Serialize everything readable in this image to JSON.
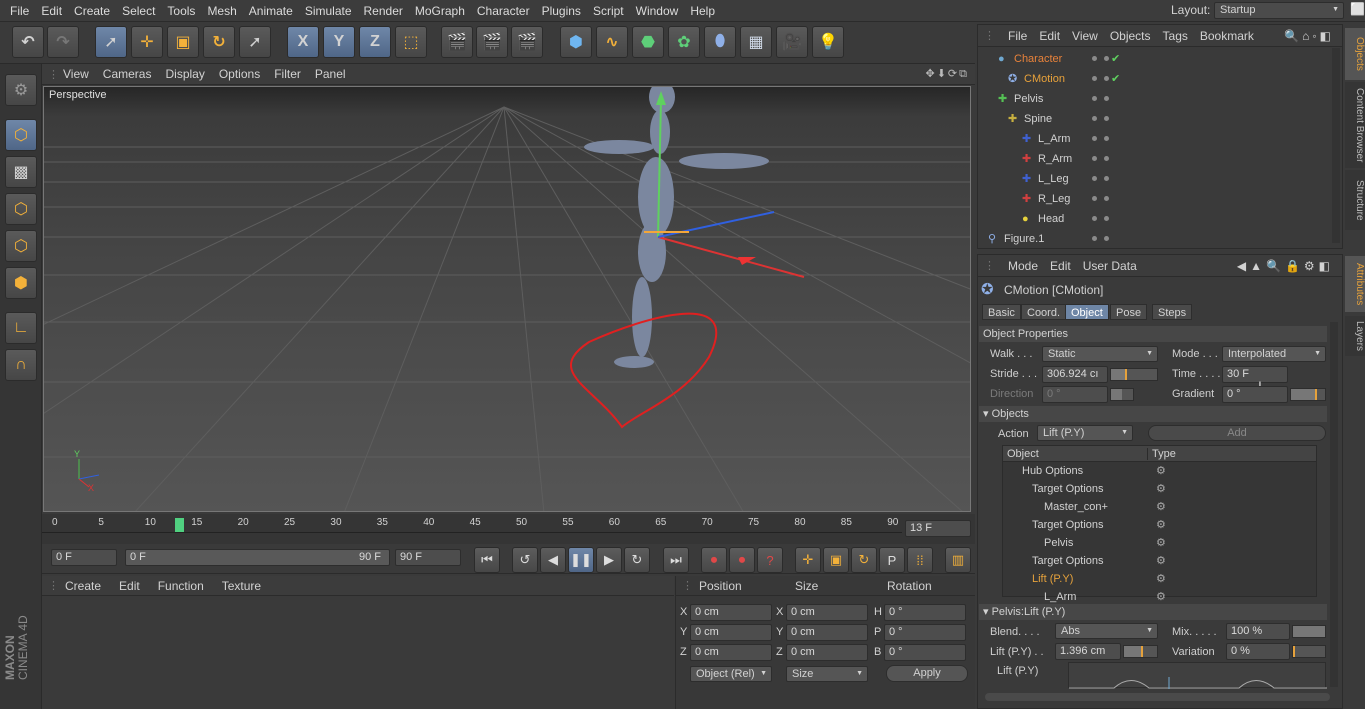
{
  "menubar": {
    "items": [
      "File",
      "Edit",
      "Create",
      "Select",
      "Tools",
      "Mesh",
      "Animate",
      "Simulate",
      "Render",
      "MoGraph",
      "Character",
      "Plugins",
      "Script",
      "Window",
      "Help"
    ],
    "layout_label": "Layout:",
    "layout_value": "Startup"
  },
  "toolbar": {
    "axis_x": "X",
    "axis_y": "Y",
    "axis_z": "Z"
  },
  "viewport": {
    "menu": [
      "View",
      "Cameras",
      "Display",
      "Options",
      "Filter",
      "Panel"
    ],
    "label": "Perspective",
    "axis_y": "Y",
    "axis_x": "X"
  },
  "timeline": {
    "ticks": [
      "0",
      "5",
      "10",
      "15",
      "20",
      "25",
      "30",
      "35",
      "40",
      "45",
      "50",
      "55",
      "60",
      "65",
      "70",
      "75",
      "80",
      "85",
      "90"
    ],
    "current_frame": "13 F",
    "playhead_frame": 13,
    "start": "0 F",
    "range_start": "0 F",
    "range_end": "90 F",
    "end": "90 F"
  },
  "material": {
    "menu": [
      "Create",
      "Edit",
      "Function",
      "Texture"
    ]
  },
  "coord": {
    "headers": [
      "Position",
      "Size",
      "Rotation"
    ],
    "rows": [
      {
        "pl": "X",
        "pv": "0 cm",
        "sl": "X",
        "sv": "0 cm",
        "rl": "H",
        "rv": "0 °"
      },
      {
        "pl": "Y",
        "pv": "0 cm",
        "sl": "Y",
        "sv": "0 cm",
        "rl": "P",
        "rv": "0 °"
      },
      {
        "pl": "Z",
        "pv": "0 cm",
        "sl": "Z",
        "sv": "0 cm",
        "rl": "B",
        "rv": "0 °"
      }
    ],
    "mode": "Object (Rel)",
    "size_mode": "Size",
    "apply": "Apply"
  },
  "objects": {
    "menu": [
      "File",
      "Edit",
      "View",
      "Objects",
      "Tags",
      "Bookmark"
    ],
    "items": [
      {
        "name": "Character",
        "color": "#e8823a"
      },
      {
        "name": "CMotion",
        "color": "#e8a23a"
      },
      {
        "name": "Pelvis",
        "color": "#d2d2d2"
      },
      {
        "name": "Spine",
        "color": "#d2d2d2"
      },
      {
        "name": "L_Arm",
        "color": "#d2d2d2"
      },
      {
        "name": "R_Arm",
        "color": "#d2d2d2"
      },
      {
        "name": "L_Leg",
        "color": "#d2d2d2"
      },
      {
        "name": "R_Leg",
        "color": "#d2d2d2"
      },
      {
        "name": "Head",
        "color": "#d2d2d2"
      },
      {
        "name": "Figure.1",
        "color": "#d2d2d2"
      }
    ],
    "side_tabs": [
      "Objects",
      "Content Browser",
      "Structure"
    ]
  },
  "attributes": {
    "menu": [
      "Mode",
      "Edit",
      "User Data"
    ],
    "title": "CMotion [CMotion]",
    "tabs": [
      "Basic",
      "Coord.",
      "Object",
      "Pose",
      "Steps"
    ],
    "section_object_props": "Object Properties",
    "walk_label": "Walk . . .",
    "walk_value": "Static",
    "mode_label": "Mode . . .",
    "mode_value": "Interpolated",
    "stride_label": "Stride . . .",
    "stride_value": "306.924 cı",
    "time_label": "Time . . . .",
    "time_value": "30 F",
    "direction_label": "Direction",
    "direction_value": "0 °",
    "gradient_label": "Gradient",
    "gradient_value": "0 °",
    "section_objects": "▾ Objects",
    "action_label": "Action",
    "action_value": "Lift (P.Y)",
    "add_button": "Add",
    "table_headers": [
      "Object",
      "Type"
    ],
    "table_rows": [
      "Hub Options",
      "Target Options",
      "Master_con+",
      "Target Options",
      "Pelvis",
      "Target Options",
      "Lift (P.Y)",
      "L_Arm"
    ],
    "section_lift": "▾ Pelvis:Lift (P.Y)",
    "blend_label": "Blend. . . .",
    "blend_value": "Abs",
    "mix_label": "Mix. . . . .",
    "mix_value": "100 %",
    "lift_label": "Lift (P.Y) . .",
    "lift_value": "1.396 cm",
    "variation_label": "Variation",
    "variation_value": "0 %",
    "lift2_label": "Lift (P.Y)",
    "side_tabs": [
      "Attributes",
      "Layers"
    ]
  },
  "branding": {
    "maxon": "MAXON",
    "product": "CINEMA 4D"
  }
}
